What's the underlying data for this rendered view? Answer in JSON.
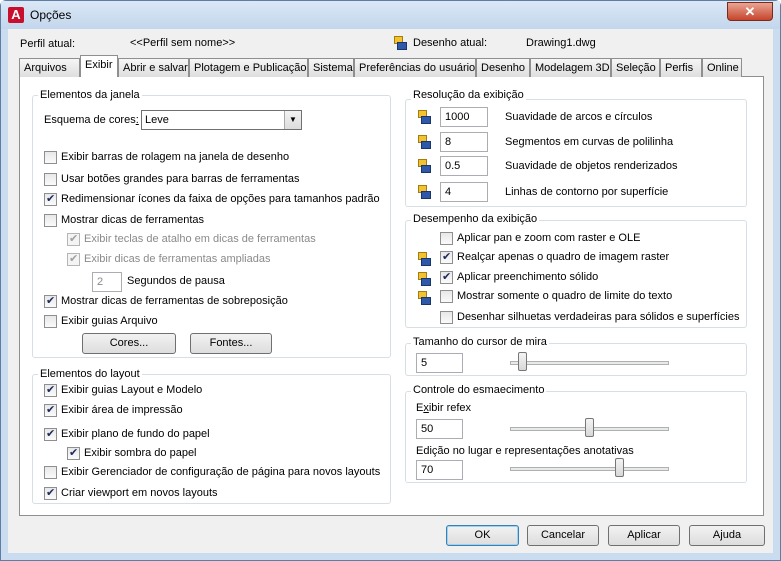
{
  "window": {
    "title": "Opções",
    "close_glyph": "✕"
  },
  "header": {
    "profile_label": "Perfil atual:",
    "profile_value": "<<Perfil sem nome>>",
    "drawing_label": "Desenho atual:",
    "drawing_value": "Drawing1.dwg"
  },
  "tabs": [
    "Arquivos",
    "Exibir",
    "Abrir e salvar",
    "Plotagem e Publicação",
    "Sistema",
    "Preferências do usuário",
    "Desenho",
    "Modelagem 3D",
    "Seleção",
    "Perfis",
    "Online"
  ],
  "active_tab": "Exibir",
  "window_elements": {
    "legend": "Elementos da janela",
    "color_scheme_label": "Esquema de cores:",
    "color_scheme_value": "Leve",
    "options": [
      {
        "label": "Exibir barras de rolagem na janela de desenho",
        "checked": false
      },
      {
        "label": "Usar botões grandes para barras de ferramentas",
        "checked": false
      },
      {
        "label": "Redimensionar ícones da faixa de opções para tamanhos padrão",
        "checked": true
      },
      {
        "label": "Mostrar dicas de ferramentas",
        "checked": false
      }
    ],
    "sub_options": [
      {
        "label": "Exibir teclas de atalho em dicas de ferramentas",
        "checked": true,
        "disabled": true
      },
      {
        "label": "Exibir dicas de ferramentas ampliadas",
        "checked": true,
        "disabled": true
      }
    ],
    "delay_value": "2",
    "delay_label": "Segundos de pausa",
    "options2": [
      {
        "label": "Mostrar dicas de ferramentas de sobreposição",
        "checked": true
      },
      {
        "label": "Exibir guias Arquivo",
        "checked": false
      }
    ],
    "colors_button": "Cores...",
    "fonts_button": "Fontes..."
  },
  "layout_elements": {
    "legend": "Elementos do layout",
    "options": [
      {
        "label": "Exibir guias Layout e Modelo",
        "checked": true
      },
      {
        "label": "Exibir área de impressão",
        "checked": true
      },
      {
        "label": "Exibir plano de fundo do papel",
        "checked": true
      },
      {
        "label": "Exibir sombra do papel",
        "checked": true
      },
      {
        "label": "Exibir Gerenciador de configuração de página para novos layouts",
        "checked": false
      },
      {
        "label": "Criar viewport em novos layouts",
        "checked": true
      }
    ]
  },
  "resolution": {
    "legend": "Resolução da exibição",
    "rows": [
      {
        "value": "1000",
        "label": "Suavidade de arcos e círculos"
      },
      {
        "value": "8",
        "label": "Segmentos em curvas de polilinha"
      },
      {
        "value": "0.5",
        "label": "Suavidade de objetos renderizados"
      },
      {
        "value": "4",
        "label": "Linhas de contorno por superfície"
      }
    ]
  },
  "performance": {
    "legend": "Desempenho da exibição",
    "options": [
      {
        "label": "Aplicar pan e zoom com raster e OLE",
        "checked": false,
        "icon": false
      },
      {
        "label": "Realçar apenas o quadro de imagem raster",
        "checked": true,
        "icon": true
      },
      {
        "label": "Aplicar preenchimento sólido",
        "checked": true,
        "icon": true
      },
      {
        "label": "Mostrar somente o quadro de limite do texto",
        "checked": false,
        "icon": true
      },
      {
        "label": "Desenhar silhuetas verdadeiras para sólidos e superfícies",
        "checked": false,
        "icon": false
      }
    ]
  },
  "crosshair": {
    "legend": "Tamanho do cursor de mira",
    "value": "5",
    "fraction": 0.05
  },
  "fade": {
    "legend": "Controle do esmaecimento",
    "xref_label": "Exibir refex",
    "xref_value": "50",
    "xref_fraction": 0.5,
    "inplace_label": "Edição no lugar e representações anotativas",
    "inplace_value": "70",
    "inplace_fraction": 0.7
  },
  "buttons": {
    "ok": "OK",
    "cancel": "Cancelar",
    "apply": "Aplicar",
    "help": "Ajuda"
  },
  "icons": {
    "app": "autocad-logo-icon",
    "drawing": "drawing-setting-icon"
  }
}
